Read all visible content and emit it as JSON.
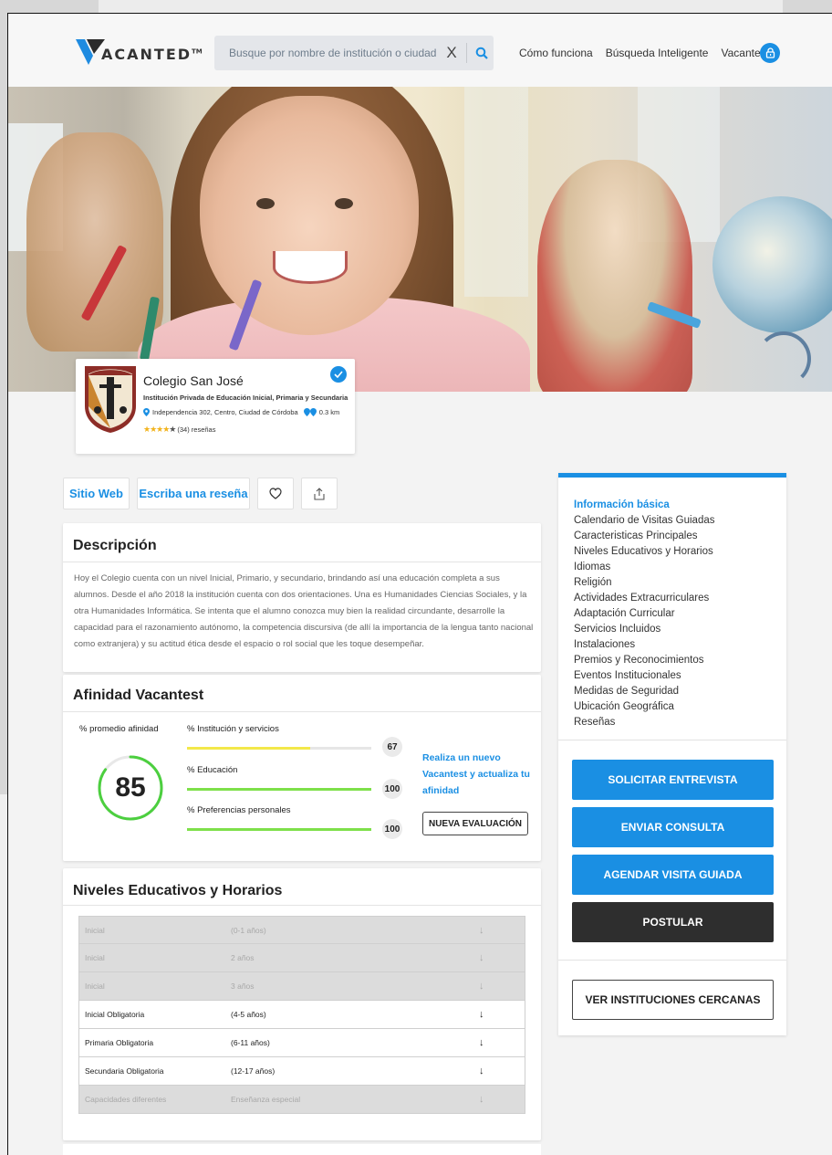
{
  "header": {
    "brand_v": "V",
    "brand_text": "ACANTED",
    "brand_tm": "TM",
    "search_placeholder": "Busque por nombre de institución o ciudad",
    "clear_label": "X",
    "nav": [
      "Cómo funciona",
      "Búsqueda Inteligente",
      "Vacantest"
    ]
  },
  "school": {
    "name": "Colegio San José",
    "type": "Institución Privada de Educación Inicial, Primaria y Secundaria",
    "address": "Independencia 302, Centro, Ciudad de Córdoba",
    "distance": "0.3 km",
    "rating": 4,
    "reviews": "(34) reseñas",
    "crest_label": "COLEGIO SAN JOSE"
  },
  "actions": {
    "website": "Sitio Web",
    "write_review": "Escriba una reseña"
  },
  "description": {
    "title": "Descripción",
    "text": "Hoy el Colegio cuenta con un nivel Inicial, Primario, y secundario, brindando así una educación completa a sus alumnos. Desde el año 2018 la institución cuenta con dos orientaciones. Una es Humanidades Ciencias Sociales, y la otra Humanidades Informática. Se intenta que el alumno conozca muy bien la realidad circundante, desarrolle la capacidad para el razonamiento autónomo, la competencia discursiva (de allí la importancia de la lengua tanto nacional como extranjera) y su actitud ética desde el espacio o rol social que les toque desempeñar."
  },
  "affinity": {
    "title": "Afinidad Vacantest",
    "avg_label": "% promedio afinidad",
    "avg_value": "85",
    "avg_fraction": 0.85,
    "colors": {
      "ring": "#4ccf3f",
      "yellow": "#f3e84a",
      "green": "#7ee04a"
    },
    "metrics": [
      {
        "label": "% Institución y servicios",
        "score": "67",
        "fraction": 0.67
      },
      {
        "label": "% Educación",
        "score": "100",
        "fraction": 1.0
      },
      {
        "label": "% Preferencias personales",
        "score": "100",
        "fraction": 1.0
      }
    ],
    "cta_text": "Realiza un nuevo Vacantest y actualiza tu afinidad",
    "new_eval": "NUEVA EVALUACIÓN"
  },
  "levels": {
    "title": "Niveles Educativos y Horarios",
    "rows": [
      {
        "name": "Inicial",
        "age": "(0-1 años)",
        "enabled": false
      },
      {
        "name": "Inicial",
        "age": "2 años",
        "enabled": false
      },
      {
        "name": "Inicial",
        "age": "3 años",
        "enabled": false
      },
      {
        "name": "Inicial Obligatoria",
        "age": "(4-5 años)",
        "enabled": true
      },
      {
        "name": "Primaria Obligatoria",
        "age": "(6-11 años)",
        "enabled": true
      },
      {
        "name": "Secundaria Obligatoria",
        "age": "(12-17 años)",
        "enabled": true
      },
      {
        "name": "Capacidades diferentes",
        "age": "Enseñanza especial",
        "enabled": false
      }
    ],
    "arrow": "↓"
  },
  "sidebar": {
    "nav": [
      "Información básica",
      "Calendario de Visitas Guiadas",
      "Caracteristicas Principales",
      "Niveles Educativos y Horarios",
      "Idiomas",
      "Religión",
      "Actividades Extracurriculares",
      "Adaptación Curricular",
      "Servicios Incluidos",
      "Instalaciones",
      "Premios y Reconocimientos",
      "Eventos Institucionales",
      "Medidas de Seguridad",
      "Ubicación Geográfica",
      "Reseñas"
    ],
    "buttons": {
      "interview": "SOLICITAR ENTREVISTA",
      "inquiry": "ENVIAR CONSULTA",
      "visit": "AGENDAR VISITA GUIADA",
      "apply": "POSTULAR",
      "nearby": "VER INSTITUCIONES CERCANAS"
    },
    "accent": "#1a8fe3"
  }
}
